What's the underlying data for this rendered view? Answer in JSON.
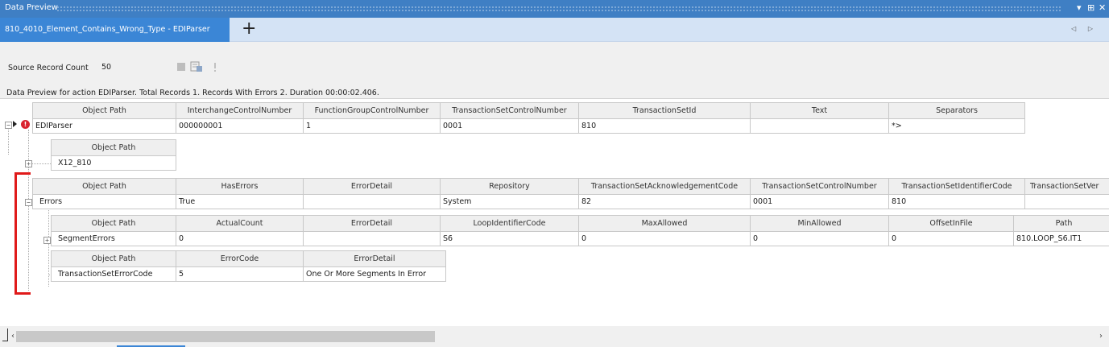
{
  "window": {
    "title": "Data Preview",
    "controls": [
      "▾",
      "⊞",
      "✕"
    ]
  },
  "tab": {
    "label": "810_4010_Element_Contains_Wrong_Type - EDIParser",
    "add": "+",
    "nav": "◁ ▷"
  },
  "toolbar": {
    "source_label": "Source Record Count",
    "source_value": "50"
  },
  "status": "Data Preview for action EDIParser. Total Records 1. Records With Errors 2. Duration 00:00:02.406.",
  "root": {
    "headers": [
      "Object Path",
      "InterchangeControlNumber",
      "FunctionGroupControlNumber",
      "TransactionSetControlNumber",
      "TransactionSetId",
      "Text",
      "Separators"
    ],
    "row": [
      "EDIParser",
      "000000001",
      "1",
      "0001",
      "810",
      "",
      "*>"
    ]
  },
  "x12": {
    "headers": [
      "Object Path"
    ],
    "row": [
      "X12_810"
    ]
  },
  "errors": {
    "headers": [
      "Object Path",
      "HasErrors",
      "ErrorDetail",
      "Repository",
      "TransactionSetAcknowledgementCode",
      "TransactionSetControlNumber",
      "TransactionSetIdentifierCode",
      "TransactionSetVer"
    ],
    "row": [
      "Errors",
      "True",
      "",
      "System",
      "82",
      "0001",
      "810",
      ""
    ]
  },
  "segment_errors": {
    "headers": [
      "Object Path",
      "ActualCount",
      "ErrorDetail",
      "LoopIdentifierCode",
      "MaxAllowed",
      "MinAllowed",
      "OffsetInFile",
      "Path"
    ],
    "row": [
      "SegmentErrors",
      "0",
      "",
      "S6",
      "0",
      "0",
      "0",
      "810.LOOP_S6.IT1"
    ]
  },
  "ts_error": {
    "headers": [
      "Object Path",
      "ErrorCode",
      "ErrorDetail"
    ],
    "row": [
      "TransactionSetErrorCode",
      "5",
      "One Or More Segments In Error"
    ]
  },
  "scroll": {
    "left": "‹",
    "right": "›"
  }
}
